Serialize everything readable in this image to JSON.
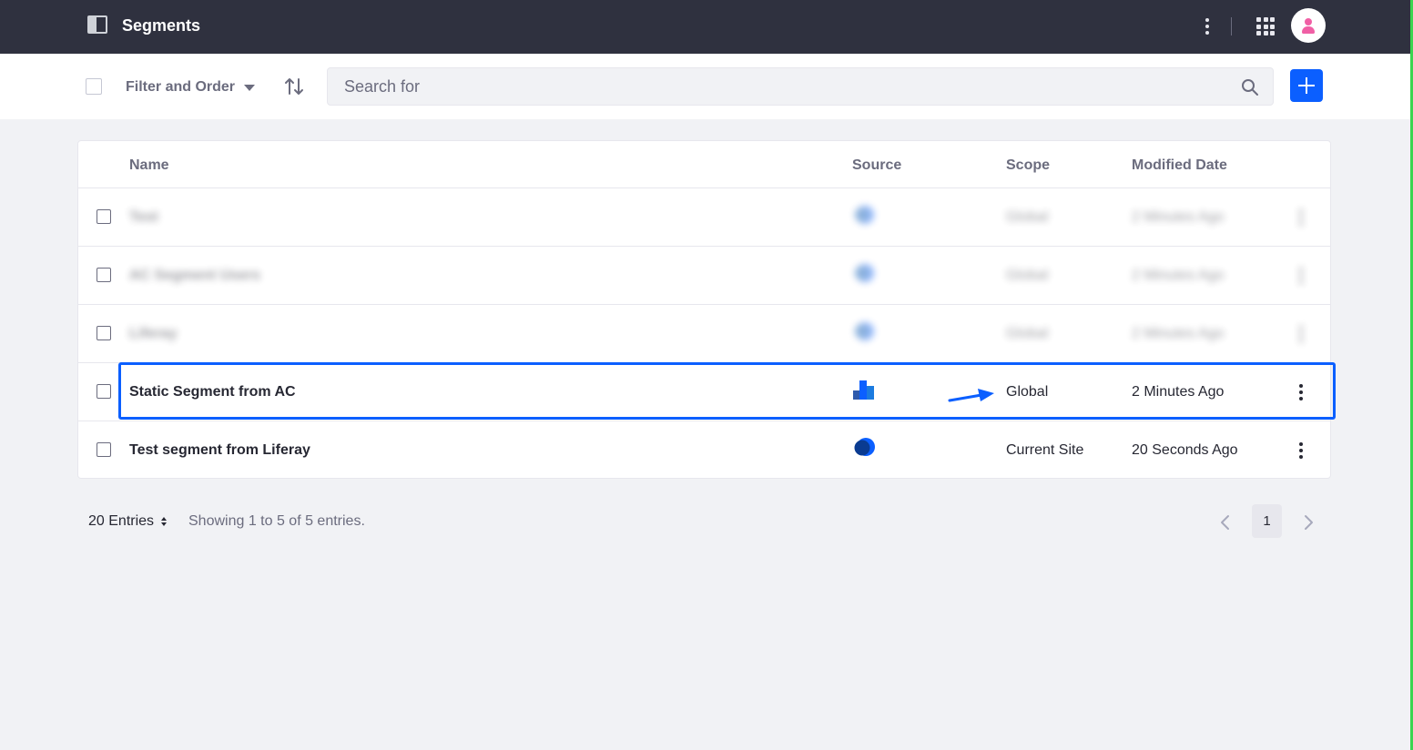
{
  "header": {
    "title": "Segments",
    "icons": {
      "panel": "product-menu-icon",
      "more": "kebab-icon",
      "apps": "apps-grid-icon",
      "user": "user-avatar-icon"
    }
  },
  "toolbar": {
    "filter_label": "Filter and Order",
    "search_placeholder": "Search for",
    "add_button_label": "Add"
  },
  "table": {
    "columns": {
      "name": "Name",
      "source": "Source",
      "scope": "Scope",
      "modified": "Modified Date"
    },
    "rows": [
      {
        "name": "Test",
        "source": "liferay-source-icon",
        "scope": "Global",
        "modified": "2 Minutes Ago",
        "blurred": true
      },
      {
        "name": "AC Segment Users",
        "source": "liferay-source-icon",
        "scope": "Global",
        "modified": "2 Minutes Ago",
        "blurred": true
      },
      {
        "name": "Liferay",
        "source": "liferay-source-icon",
        "scope": "Global",
        "modified": "2 Minutes Ago",
        "blurred": true
      },
      {
        "name": "Static Segment from AC",
        "source": "analytics-cloud-icon",
        "scope": "Global",
        "modified": "2 Minutes Ago",
        "highlighted": true
      },
      {
        "name": "Test segment from Liferay",
        "source": "liferay-source-icon",
        "scope": "Current Site",
        "modified": "20 Seconds Ago"
      }
    ]
  },
  "pagination": {
    "entries_label": "20 Entries",
    "showing_text": "Showing 1 to 5 of 5 entries.",
    "current_page": "1"
  },
  "colors": {
    "topbar": "#2f313f",
    "primary": "#0b5fff",
    "background": "#f1f2f5",
    "avatar": "#f05fa5"
  }
}
